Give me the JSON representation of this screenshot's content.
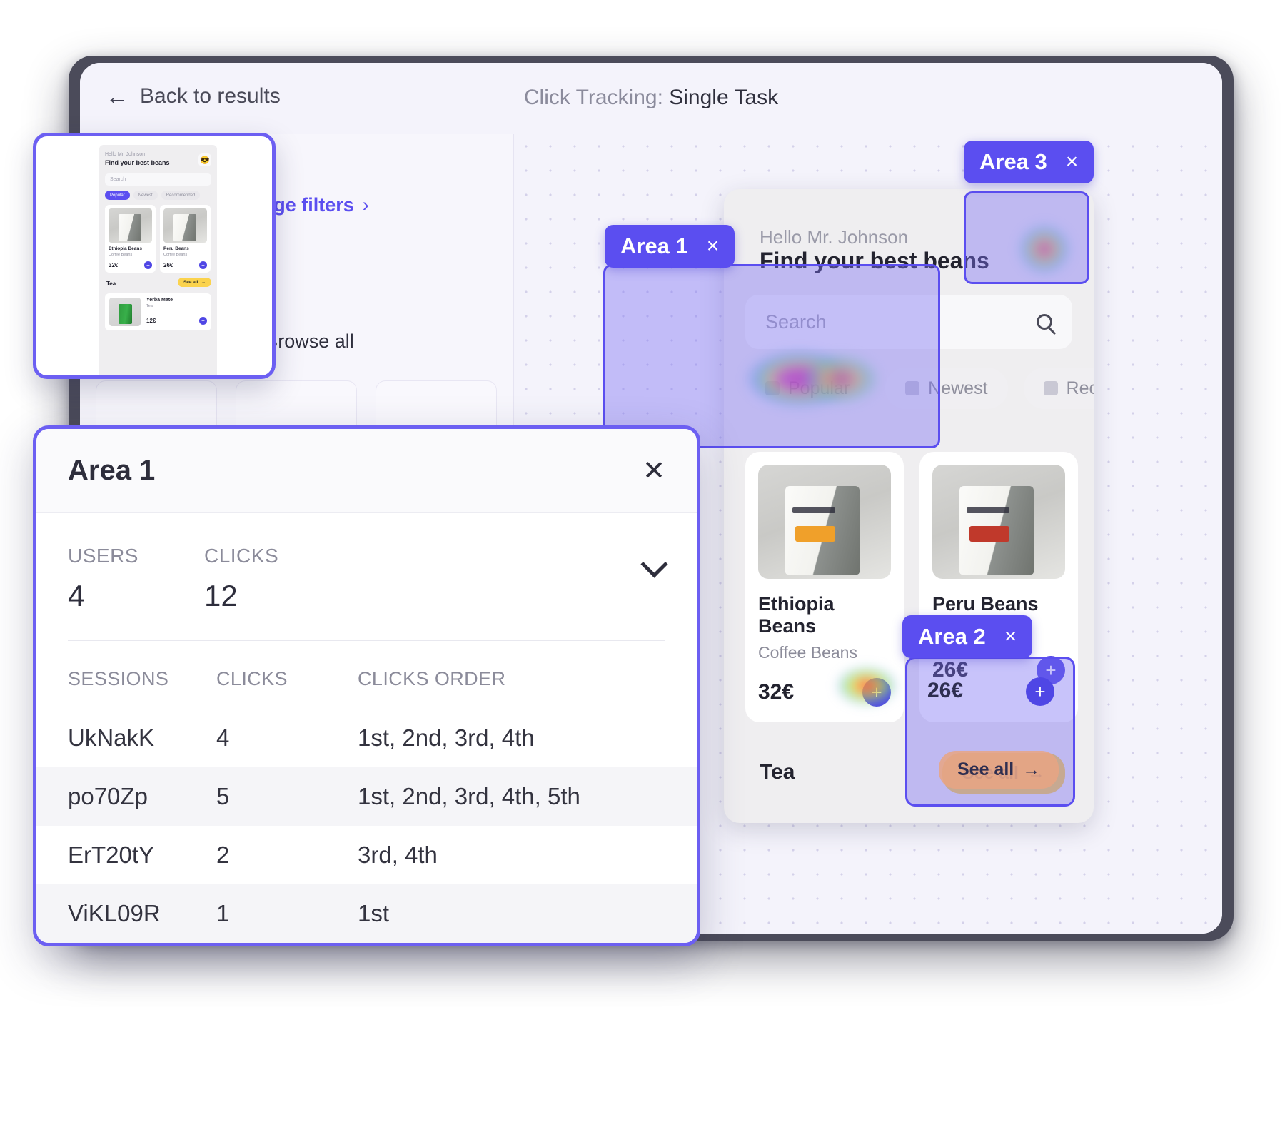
{
  "header": {
    "back_label": "Back to results",
    "back_icon": "arrow-left-icon",
    "title_prefix": "Click Tracking: ",
    "title_value": "Single Task"
  },
  "results_column": {
    "manage_filters": "Manage filters",
    "manage_filters_chevron": "›",
    "browse_all": "Browse all",
    "search_icon": "search-icon"
  },
  "areas": [
    {
      "label": "Area 1",
      "close": "×"
    },
    {
      "label": "Area 2",
      "close": "×"
    },
    {
      "label": "Area 3",
      "close": "×"
    }
  ],
  "preview": {
    "greeting": "Hello Mr. Johnson",
    "title": "Find your best beans",
    "search_placeholder": "Search",
    "search_icon": "search-icon",
    "avatar_emoji": "😎",
    "chips": [
      {
        "label": "Popular",
        "active": true
      },
      {
        "label": "Newest",
        "active": false
      },
      {
        "label": "Recommended",
        "active": false
      }
    ],
    "products": [
      {
        "name": "Ethiopia Beans",
        "category": "Coffee Beans",
        "price": "32€",
        "add": "+"
      },
      {
        "name": "Peru Beans",
        "category": "Coffee Beans",
        "price": "26€",
        "add": "+"
      }
    ],
    "section_title": "Tea",
    "see_all": "See all",
    "see_all_arrow": "→",
    "tea_product": {
      "name": "Yerba Mate",
      "category": "Tea",
      "price": "12€",
      "add": "+"
    }
  },
  "detail_panel": {
    "title": "Area 1",
    "close_icon": "close-icon",
    "expand_icon": "chevron-down-icon",
    "summary": [
      {
        "label": "USERS",
        "value": "4"
      },
      {
        "label": "CLICKS",
        "value": "12"
      }
    ],
    "columns": [
      "SESSIONS",
      "CLICKS",
      "CLICKS ORDER"
    ],
    "rows": [
      {
        "session": "UkNakK",
        "clicks": "4",
        "order": "1st, 2nd, 3rd, 4th"
      },
      {
        "session": "po70Zp",
        "clicks": "5",
        "order": "1st, 2nd, 3rd, 4th, 5th"
      },
      {
        "session": "ErT20tY",
        "clicks": "2",
        "order": "3rd, 4th"
      },
      {
        "session": "ViKL09R",
        "clicks": "1",
        "order": "1st"
      }
    ]
  },
  "colors": {
    "accent": "#5b4ef0",
    "region_fill": "#7c71f2",
    "canvas": "#f4f3fb",
    "shell": "#4b4b5a",
    "yellow": "#fbd34d"
  }
}
